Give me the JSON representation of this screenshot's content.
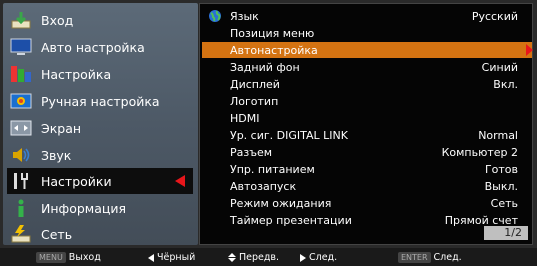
{
  "left_menu": {
    "items": [
      {
        "label": "Вход",
        "icon": "input-icon"
      },
      {
        "label": "Авто настройка",
        "icon": "auto-setup-icon"
      },
      {
        "label": "Настройка",
        "icon": "setting-icon"
      },
      {
        "label": "Ручная настройка",
        "icon": "manual-setting-icon"
      },
      {
        "label": "Экран",
        "icon": "screen-icon"
      },
      {
        "label": "Звук",
        "icon": "sound-icon"
      },
      {
        "label": "Настройки",
        "icon": "settings-icon"
      },
      {
        "label": "Информация",
        "icon": "information-icon"
      },
      {
        "label": "Сеть",
        "icon": "network-icon"
      }
    ],
    "active_index": 6
  },
  "settings_panel": {
    "items": [
      {
        "label": "Язык",
        "value": "Русский"
      },
      {
        "label": "Позиция меню",
        "value": ""
      },
      {
        "label": "Автонастройка",
        "value": ""
      },
      {
        "label": "Задний фон",
        "value": "Синий"
      },
      {
        "label": "Дисплей",
        "value": "Вкл."
      },
      {
        "label": "Логотип",
        "value": ""
      },
      {
        "label": "HDMI",
        "value": ""
      },
      {
        "label": "Ур. сиг. DIGITAL LINK",
        "value": "Normal"
      },
      {
        "label": "Разъем",
        "value": "Компьютер 2"
      },
      {
        "label": "Упр. питанием",
        "value": "Готов"
      },
      {
        "label": "Автозапуск",
        "value": "Выкл."
      },
      {
        "label": "Режим ожидания",
        "value": "Сеть"
      },
      {
        "label": "Таймер презентации",
        "value": "Прямой счет"
      }
    ],
    "selected_index": 2,
    "page_indicator": "1/2"
  },
  "footer": {
    "exit_key": "MENU",
    "exit_label": "Выход",
    "back_label": "Чёрный",
    "move_label": "Передв.",
    "next_label": "След.",
    "enter_key": "ENTER",
    "enter_label": "След."
  },
  "colors": {
    "selected_row": "#d47312",
    "active_arrow": "#e8161b",
    "left_panel": "#4d5966"
  }
}
